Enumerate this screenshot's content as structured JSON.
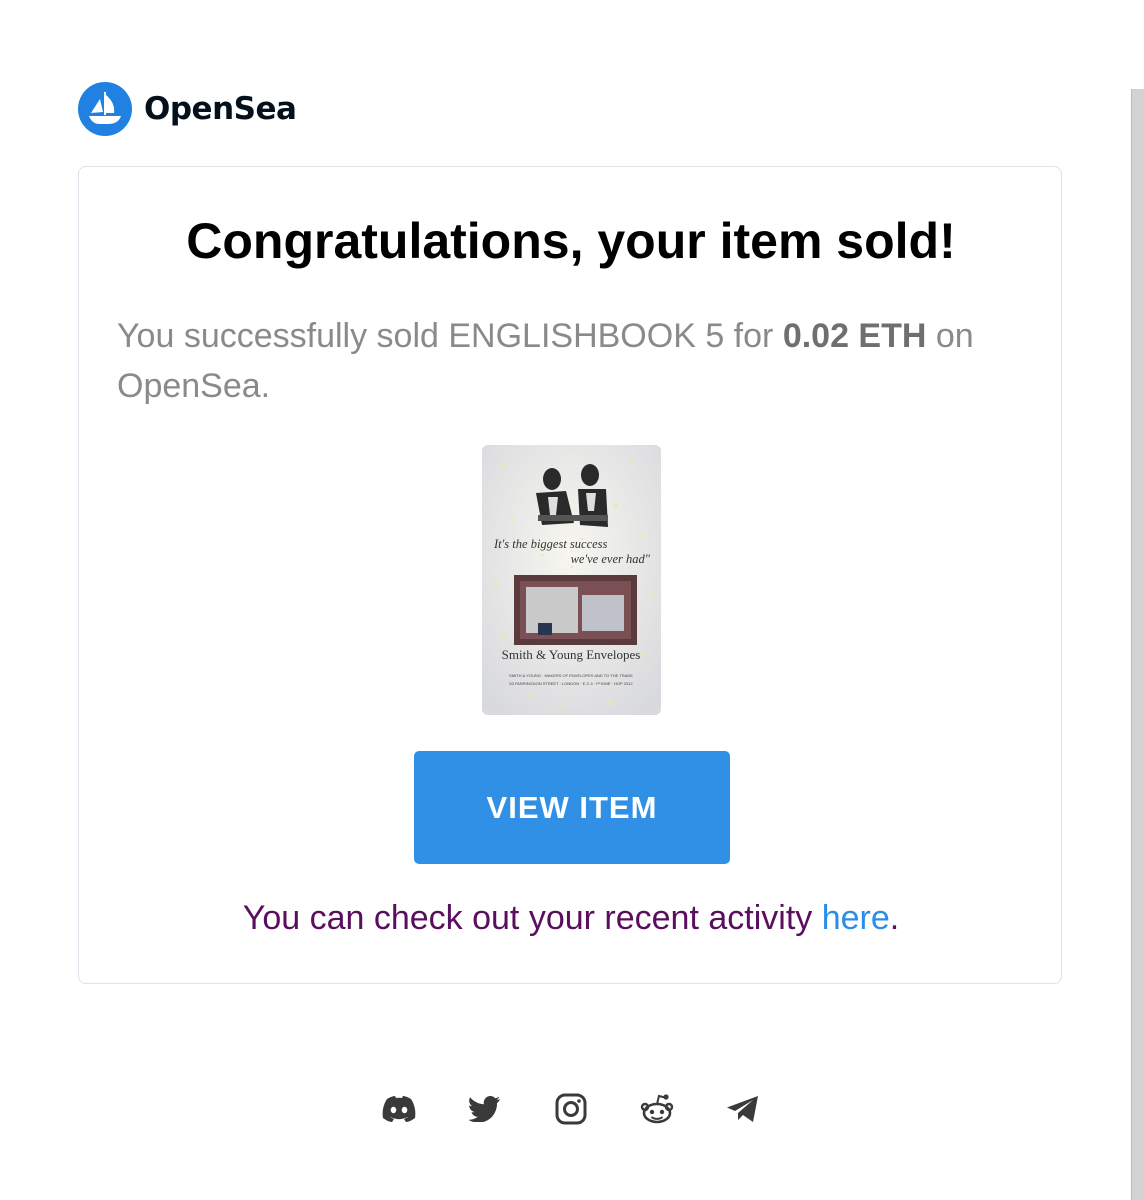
{
  "brand": {
    "name": "OpenSea",
    "logo_icon": "opensea-boat-icon",
    "color": "#2081e2"
  },
  "email": {
    "headline": "Congratulations, your item sold!",
    "message_prefix": "You successfully sold ENGLISHBOOK 5 for ",
    "price": "0.02 ETH",
    "message_suffix": " on OpenSea.",
    "nft_image": {
      "lines": [
        "It's the biggest success",
        "we've ever had\"",
        "Smith & Young Envelopes"
      ],
      "fine_print": [
        "SMITH & YOUNG · MAKERS OF ENVELOPES AND TO THE TRADE",
        "53 FARRINGDON STREET · LONDON · E.C.4 · PHONE · HOP 2312"
      ]
    },
    "view_button_label": "VIEW ITEM",
    "view_button_color": "#3090e6",
    "activity_prefix": "You can check out your recent activity ",
    "activity_link": "here",
    "activity_suffix": "."
  },
  "footer": {
    "social_icons": [
      "discord-icon",
      "twitter-icon",
      "instagram-icon",
      "reddit-icon",
      "telegram-icon"
    ]
  }
}
